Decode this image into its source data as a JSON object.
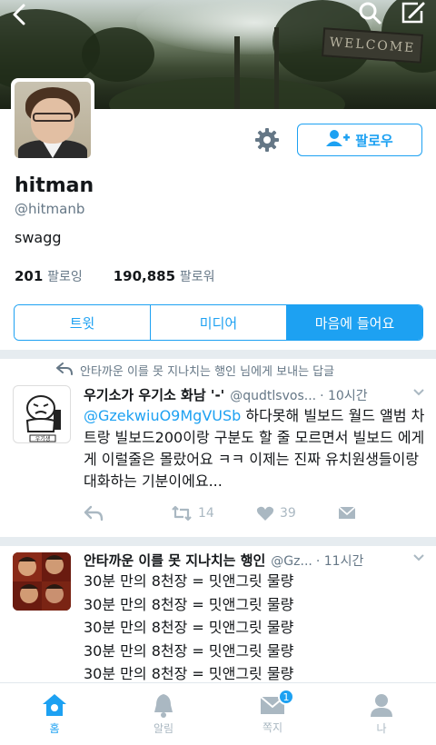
{
  "header": {
    "sign_text": "WELCOME"
  },
  "profile": {
    "name": "hitman",
    "handle": "@hitmanb",
    "bio": "swagg",
    "follow_label": "팔로우",
    "following_count": "201",
    "following_label": "팔로잉",
    "followers_count": "190,885",
    "followers_label": "팔로워"
  },
  "tabs": [
    {
      "label": "트윗",
      "active": false
    },
    {
      "label": "미디어",
      "active": false
    },
    {
      "label": "마음에 들어요",
      "active": true
    }
  ],
  "tweets": [
    {
      "context": "안타까운 이를 못 지나치는 행인 님에게 보내는 답글",
      "name": "우기소가 우기소 화남 '-'",
      "handle": "@qudtlsvos...",
      "time": "· 10시간",
      "avatar_caption": "우기생",
      "mention": "@GzekwiuO9MgVUSb",
      "text": " 하다못해 빌보드 월드 앨범 차트랑 빌보드200이랑 구분도 할 줄 모르면서 빌보드 에게게 이럴줄은 몰랐어요 ㅋㅋ 이제는 진짜 유치원생들이랑 대화하는 기분이에요...",
      "retweets": "14",
      "likes": "39"
    },
    {
      "name": "안타까운 이를 못 지나치는 행인",
      "handle": "@Gz...",
      "time": "· 11시간",
      "lines": [
        "30분 만의 8천장 = 밋앤그릿 물량",
        "30분 만의 8천장 = 밋앤그릿 물량",
        "30분 만의 8천장 = 밋앤그릿 물량",
        "30분 만의 8천장 = 밋앤그릿 물량",
        "30분 만의 8천장 = 밋앤그릿 물량"
      ]
    }
  ],
  "nav": {
    "home": "홈",
    "notifications": "알림",
    "messages": "쪽지",
    "me": "나",
    "messages_badge": "1"
  },
  "colors": {
    "accent": "#1da1f2",
    "muted": "#657786",
    "icon_gray": "#aab8c2"
  }
}
